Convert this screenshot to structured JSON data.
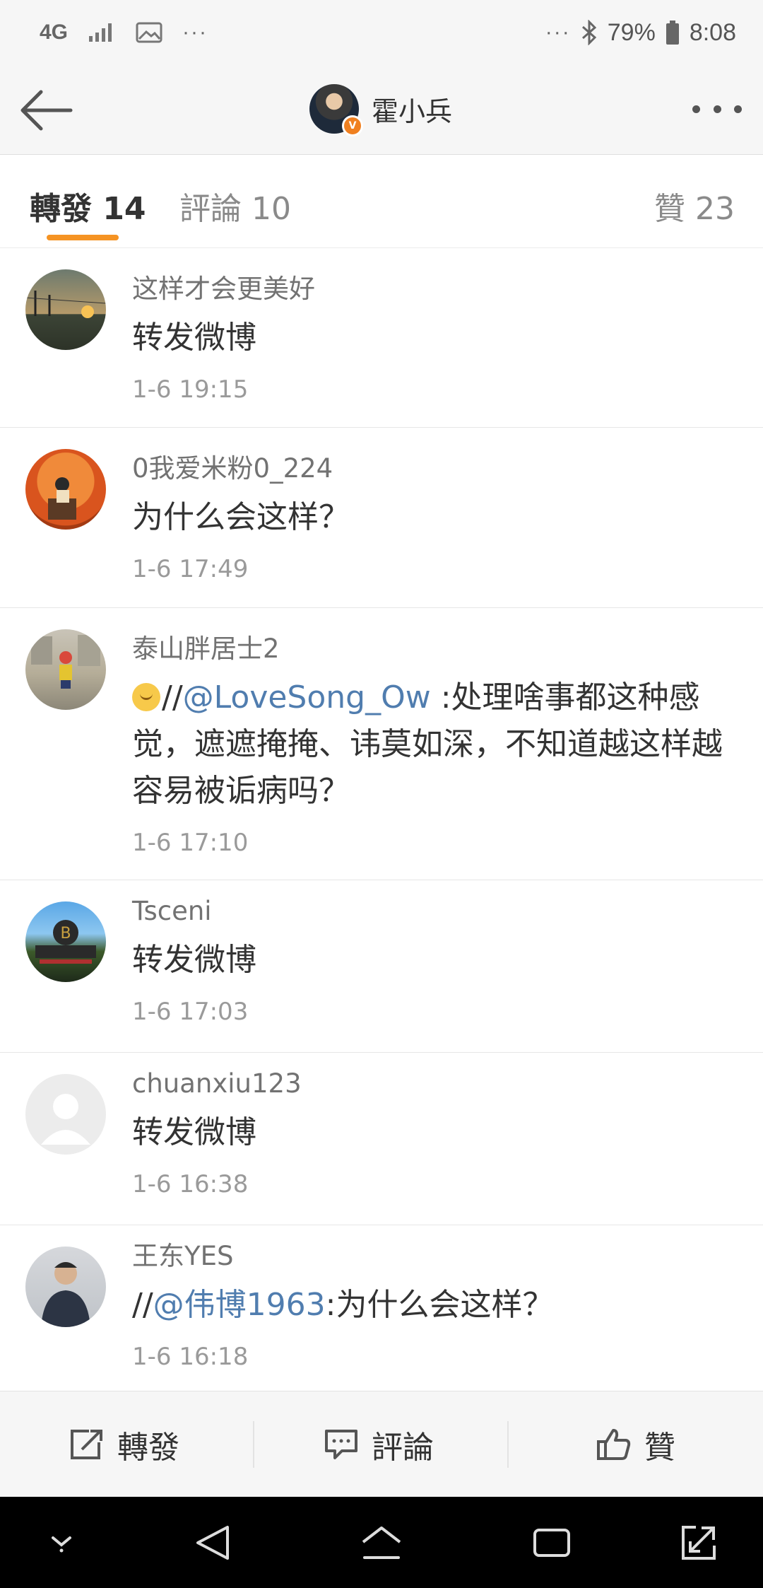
{
  "status_bar": {
    "network": "4G",
    "dots_left": "···",
    "dots_right": "···",
    "battery": "79%",
    "time": "8:08"
  },
  "header": {
    "title": "霍小兵",
    "badge": "V"
  },
  "tabs": {
    "repost": "轉發 14",
    "comment": "評論 10",
    "like": "贊 23",
    "active": "repost",
    "accent_color": "#f59323"
  },
  "reposts": [
    {
      "user": "这样才会更美好",
      "text": "转发微博",
      "time": "1-6 19:15"
    },
    {
      "user": "0我爱米粉0_224",
      "text": "为什么会这样？",
      "time": "1-6 17:49"
    },
    {
      "user": "泰山胖居士2",
      "prefix": "//",
      "mention": "@LoveSong_Ow",
      "text": " :处理啥事都这种感觉，遮遮掩掩、讳莫如深，不知道越这样越容易被诟病吗？",
      "time": "1-6 17:10"
    },
    {
      "user": "Tsceni",
      "text": "转发微博",
      "time": "1-6 17:03"
    },
    {
      "user": "chuanxiu123",
      "text": "转发微博",
      "time": "1-6 16:38"
    },
    {
      "user": "王东YES",
      "prefix": "//",
      "mention": "@伟博1963",
      "text": ":为什么会这样？",
      "time": "1-6 16:18"
    }
  ],
  "actions": {
    "repost": "轉發",
    "comment": "評論",
    "like": "贊"
  },
  "colors": {
    "mention": "#507daf",
    "bar_bg": "#f6f6f6"
  }
}
